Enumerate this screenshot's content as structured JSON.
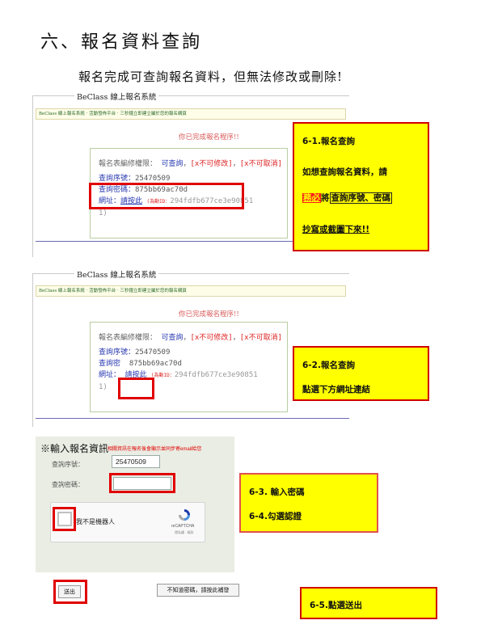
{
  "heading": "六、報名資料查詢",
  "subheading": "報名完成可查詢報名資料，但無法修改或刪除!",
  "panel1": {
    "title": "BeClass 線上報名系統",
    "topbar": "BeClass 線上報名系統 · 活動發佈平台 · 三秒鐘立即建立屬於您的報名網頁",
    "notice": "你已完成報名程序!!",
    "perm_label": "報名表編修權限：",
    "perm_view": "可查詢",
    "perm_no_edit": "[x不可修改]",
    "perm_no_delete": "[x不可取消]",
    "serial_label": "查詢序號：",
    "serial_value": "25470509",
    "pwd_label": "查詢密碼：",
    "pwd_value": "875bb69ac70d",
    "url_label": "網址：",
    "url_link": "請按此",
    "url_note": "(為動ID：",
    "url_hash": "294fdfb677ce3e90851",
    "url_hash2": "1)"
  },
  "callout1": {
    "line1": "6-1.報名查詢",
    "line2": "如想查詢報名資料，請",
    "must": "務必",
    "will": "將",
    "boxed": "查詢序號、密碼",
    "line4": "抄寫或截圖下來!!"
  },
  "panel2": {
    "title": "BeClass 線上報名系統",
    "topbar": "BeClass 線上報名系統 · 活動發佈平台 · 三秒鐘立即建立屬於您的報名網頁",
    "notice": "你已完成報名程序!!",
    "perm_label": "報名表編修權限：",
    "perm_view": "可查詢",
    "perm_no_edit": "[x不可修改]",
    "perm_no_delete": "[x不可取消]",
    "serial_label": "查詢序號：",
    "serial_value": "25470509",
    "pwd_label": "查詢密",
    "pwd_value": "875bb69ac70d",
    "url_label": "網址：",
    "url_link": "請按此",
    "url_note": "(為動ID：",
    "url_hash": "294fdfb677ce3e90851",
    "url_hash2": "1)"
  },
  "callout2": {
    "line1": "6-2.報名查詢",
    "line2": "點選下方網址連結"
  },
  "form": {
    "title": "※輸入報名資訊",
    "note": "相關資訊在報名後會顯示並同步寄email給您",
    "serial_label": "查詢序號：",
    "serial_value": "25470509",
    "pwd_label": "查詢密碼：",
    "pwd_value": "",
    "captcha_label": "我不是機器人",
    "recaptcha": "reCAPTCHA",
    "recaptcha_sub": "隱私權 - 條款",
    "submit_label": "送出",
    "forgot_label": "不知道密碼，請按此補發"
  },
  "callout3": {
    "line1": "6-3. 輸入密碼",
    "line2": "6-4.勾選認證"
  },
  "callout4": {
    "line1": "6-5.點選送出"
  },
  "colors": {
    "highlight": "#ffff00",
    "frame": "#e00000",
    "link": "#2a3ab0"
  }
}
